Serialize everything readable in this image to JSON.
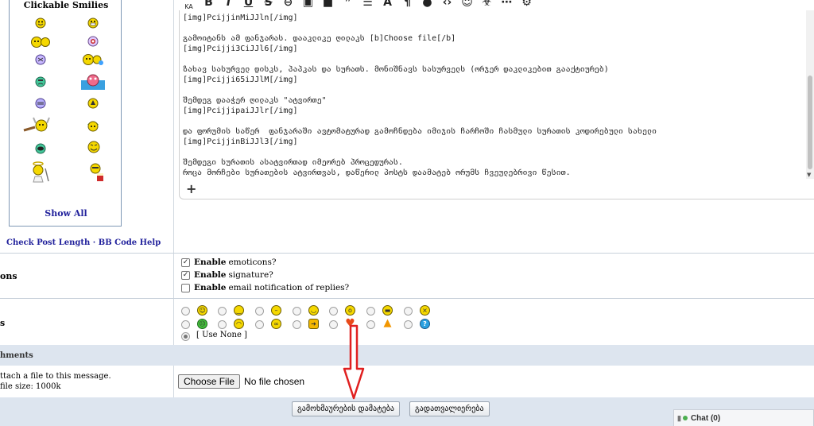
{
  "smilies_panel": {
    "title": "Clickable Smilies",
    "show_all": "Show All",
    "icons": [
      "smile-icon",
      "grin-icon",
      "thumbs-up-icon",
      "wink-icon",
      "cool-icon",
      "party-icon",
      "sad-icon",
      "fish-icon",
      "blush-icon",
      "alien-icon",
      "viking-icon",
      "soldier-icon",
      "nerd-icon",
      "laugh-icon",
      "angel-icon",
      "popcorn-icon"
    ]
  },
  "post_links": {
    "check_length": "Check Post Length",
    "sep": " · ",
    "bb_help": "BB Code Help"
  },
  "toolbar": {
    "first_label": "KA",
    "icons": [
      "font-size-icon",
      "bold-icon",
      "italic-icon",
      "underline-icon",
      "strike-icon",
      "link-icon",
      "image-icon",
      "video-icon",
      "quote-icon",
      "list-icon",
      "font-icon",
      "paragraph-icon",
      "color-icon",
      "code-icon",
      "smiley-icon",
      "biohazard-icon",
      "more-icon",
      "gear-icon"
    ]
  },
  "editor": {
    "text": "[img]PcijjinMiJJln[/img]\n\nგამოიტანს ამ ფანჯარას. დააკლიკე ღილაკს [b]Choose file[/b]\n[img]Pcijji3CiJJl6[/img]\n\nზახავ სასურველ დისკს, პაპკას და სურათს. მონიშნავს სასურველს (ორჯერ დაკლიკებით გააქტიურებ)\n[img]Pcijji65iJJlM[/img]\n\nშემდეგ დააჭერ ღილაკს \"ატვირთე\"\n[img]PcijjipaiJJlr[/img]\n\nდა ფორუმის საწერ  ფანჯარაში ავტომატურად გამოჩნდება იმიჯის ჩარჩოში ჩასმული სურათის კოდირებული სახელი\n[img]PcijjinBiJJl3[/img]\n\nშემდეგი სურათის ასატვირთად იმეორებ პროცედურას.\nროცა მორჩები სურათების ატვირთვას, დაწერილ პოსტს დაამატებ ორუმს ჩვეულებრივი წესით.",
    "add_label": "+"
  },
  "options": {
    "label": "ons",
    "items": [
      {
        "bold": "Enable",
        "text": "emoticons?",
        "checked": true
      },
      {
        "bold": "Enable",
        "text": "signature?",
        "checked": true
      },
      {
        "bold": "Enable",
        "text": "email notification of replies?",
        "checked": false
      }
    ]
  },
  "post_icons": {
    "label": "s",
    "use_none": "[ Use None ]",
    "icons": [
      "smile-icon",
      "confused-icon",
      "neutral-icon",
      "wink-icon",
      "surprised-icon",
      "big-grin-icon",
      "angry-icon",
      "sick-icon",
      "mad-icon",
      "cool-icon",
      "arrow-icon",
      "heart-icon",
      "exclamation-icon",
      "question-icon"
    ]
  },
  "attachments": {
    "header": "hments",
    "desc_line1": "ttach a file to this message.",
    "desc_line2": "file size: 1000k",
    "choose_label": "Choose File",
    "no_file": "No file chosen"
  },
  "buttons": {
    "submit": "გამოხმაურების დამატება",
    "preview": "გადათვალიერება"
  },
  "chat": {
    "label": "Chat",
    "count": "(0)"
  },
  "colors": {
    "link": "#22229c",
    "bar": "#dde5ef",
    "arrow": "#e02020"
  }
}
